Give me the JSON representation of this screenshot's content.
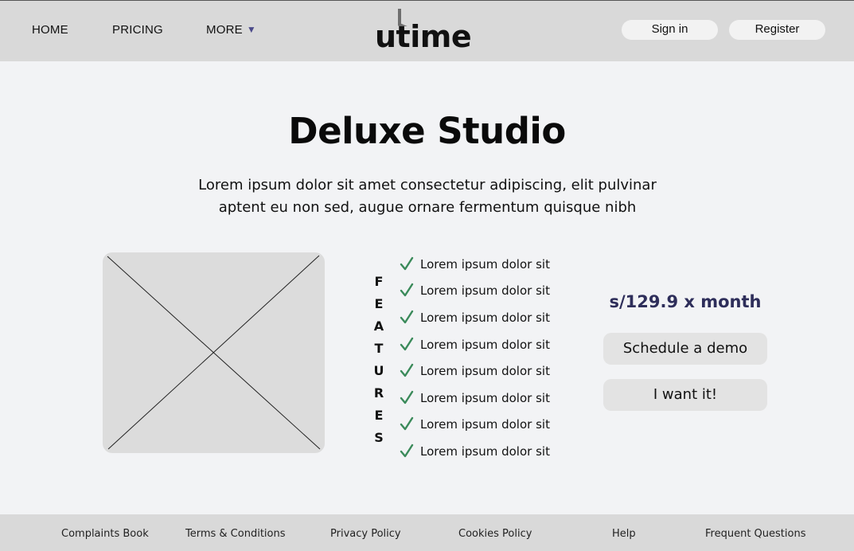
{
  "header": {
    "nav": {
      "home": "HOME",
      "pricing": "PRICING",
      "more": "MORE"
    },
    "logo_text": "utime",
    "signin_label": "Sign in",
    "register_label": "Register"
  },
  "main": {
    "title": "Deluxe Studio",
    "description": "Lorem ipsum dolor sit amet consectetur adipiscing, elit pulvinar aptent eu non sed, augue ornare fermentum quisque nibh",
    "features_heading_letters": [
      "F",
      "E",
      "A",
      "T",
      "U",
      "R",
      "E",
      "S"
    ],
    "features": [
      "Lorem ipsum dolor sit",
      "Lorem ipsum dolor sit",
      "Lorem ipsum dolor sit",
      "Lorem ipsum dolor sit",
      "Lorem ipsum dolor sit",
      "Lorem ipsum dolor sit",
      "Lorem ipsum dolor sit",
      "Lorem ipsum dolor sit"
    ],
    "price": "s/129.9 x month",
    "schedule_label": "Schedule a demo",
    "want_label": "I want it!"
  },
  "footer": {
    "links": [
      "Complaints Book",
      "Terms & Conditions",
      "Privacy Policy",
      "Cookies Policy",
      "Help",
      "Frequent Questions"
    ]
  },
  "colors": {
    "header_bg": "#d9d9d9",
    "page_bg": "#f2f3f5",
    "accent": "#4b4a8a",
    "price": "#2e2e5a",
    "check": "#3a8a5a"
  }
}
